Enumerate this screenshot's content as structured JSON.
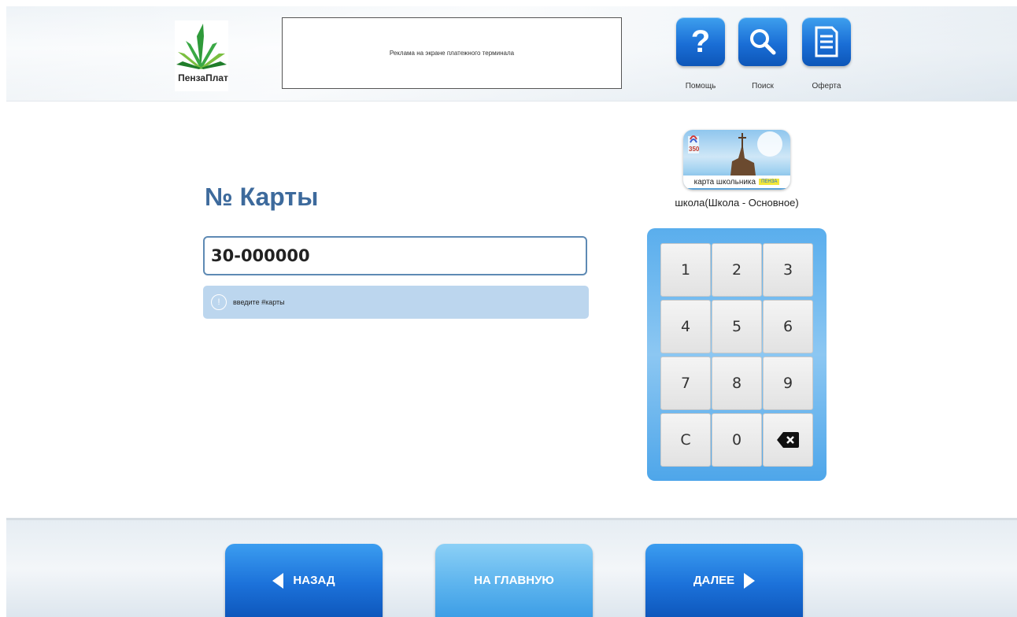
{
  "header": {
    "logo_text": "ПензаПлат",
    "ad_text": "Реклама на экране платежного терминала",
    "buttons": [
      {
        "label": "Помощь",
        "icon": "help-icon"
      },
      {
        "label": "Поиск",
        "icon": "search-icon"
      },
      {
        "label": "Оферта",
        "icon": "document-icon"
      }
    ]
  },
  "main": {
    "title": "№ Карты",
    "card_number_value": "30-000000",
    "hint": "введите #карты",
    "hint_icon": "!"
  },
  "service": {
    "card_label": "карта школьника",
    "card_badge": "ПЕНЗА",
    "card_year": "350",
    "name": "школа(Школа - Основное)"
  },
  "keypad": {
    "keys": [
      "1",
      "2",
      "3",
      "4",
      "5",
      "6",
      "7",
      "8",
      "9",
      "C",
      "0"
    ],
    "backspace_icon": "backspace-icon"
  },
  "footer": {
    "back_label": "НАЗАД",
    "home_label": "НА ГЛАВНУЮ",
    "next_label": "ДАЛЕЕ"
  },
  "colors": {
    "accent_blue": "#1a6ed6",
    "title_blue": "#3d6a9c",
    "hint_bg": "#bcd6ee"
  }
}
